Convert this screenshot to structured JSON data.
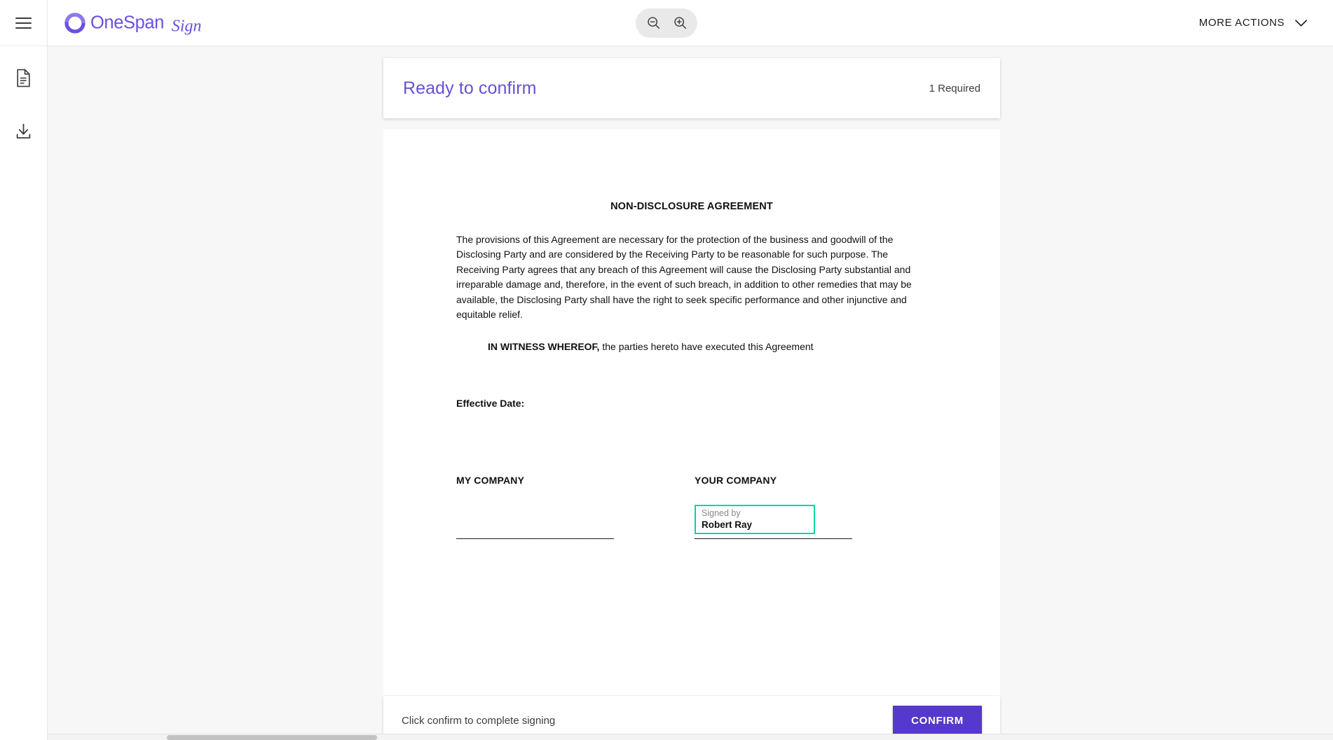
{
  "header": {
    "menu_icon": "hamburger-menu-icon",
    "brand": "OneSpan Sign",
    "zoom_out_icon": "zoom-out-icon",
    "zoom_in_icon": "zoom-in-icon",
    "more_actions_label": "MORE ACTIONS",
    "chevron_icon": "chevron-down-icon"
  },
  "sidebar": {
    "items": [
      {
        "icon": "document-icon",
        "name": "documents"
      },
      {
        "icon": "download-icon",
        "name": "download"
      }
    ]
  },
  "status_banner": {
    "title": "Ready to confirm",
    "required": "1 Required"
  },
  "document": {
    "title": "NON-DISCLOSURE AGREEMENT",
    "paragraph": "The provisions of this Agreement are necessary for the protection of the business and goodwill of the Disclosing Party and are considered by the Receiving Party to be reasonable for such purpose. The Receiving Party agrees that any breach of this Agreement will cause the Disclosing Party substantial and irreparable damage and, therefore, in the event of such breach, in addition to other remedies that may be available, the Disclosing Party shall have the right to seek specific performance and other injunctive and equitable relief.",
    "witness_bold": "IN WITNESS WHEREOF,",
    "witness_rest": " the parties hereto have executed this Agreement",
    "effective_date_label": "Effective Date:",
    "my_company": "MY COMPANY",
    "your_company": "YOUR COMPANY",
    "signature_line_left": "______________________________",
    "signature_line_right": "______________________________",
    "signature_field": {
      "label": "Signed by",
      "value": "Robert Ray",
      "border_color": "#00d6a6"
    }
  },
  "action_bar": {
    "hint": "Click confirm to complete signing",
    "confirm_label": "CONFIRM",
    "confirm_color": "#5538cd"
  },
  "colors": {
    "brand_purple": "#6552d7",
    "accent_green": "#00d6a6",
    "workspace_bg": "#f7f7f7"
  }
}
